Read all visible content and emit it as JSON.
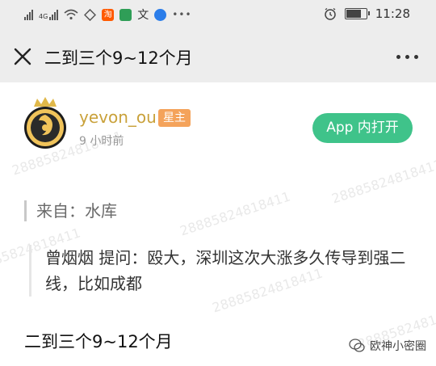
{
  "status_bar": {
    "signal_left_label": "4G",
    "icons": [
      "signal-icon",
      "signal-4g-icon",
      "wifi-icon",
      "app-icon-1",
      "app-icon-taobao",
      "app-icon-green",
      "app-icon-wen",
      "app-icon-blue",
      "more-dots-icon"
    ],
    "taobao_label": "淘",
    "wen_label": "文",
    "time": "11:28"
  },
  "navbar": {
    "title": "二到三个9~12个月"
  },
  "post": {
    "username": "yevon_ou",
    "badge": "星主",
    "time_ago": "9 小时前",
    "open_app_label": "App 内打开",
    "source": "来自：水库",
    "question": "曾烟烟 提问：殴大，深圳这次大涨多久传导到强二线，比如成都",
    "answer": "二到三个9~12个月",
    "watermark": "28885824818411",
    "brand": "欧神小密圈"
  },
  "colors": {
    "accent_green": "#3fc38a",
    "username_gold": "#c9a13a",
    "badge_orange": "#f4a35b"
  }
}
